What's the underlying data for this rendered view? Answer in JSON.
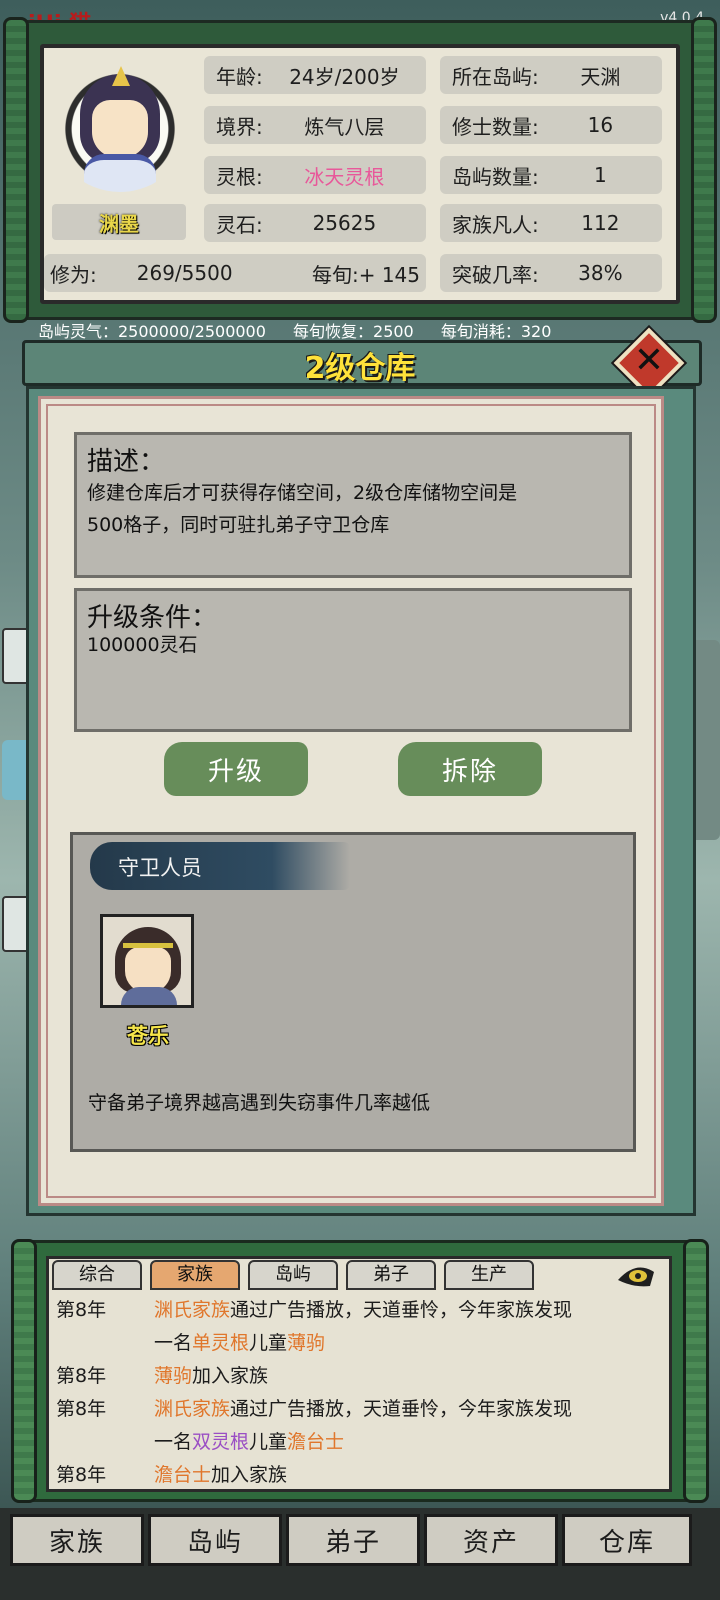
{
  "app": {
    "version": "v4.0.4",
    "corner_logo": "iHi 猫"
  },
  "character": {
    "name": "渊墨",
    "stats_left": [
      {
        "key": "年龄:",
        "value": "24岁/200岁"
      },
      {
        "key": "境界:",
        "value": "炼气八层"
      },
      {
        "key": "灵根:",
        "value": "冰天灵根"
      },
      {
        "key": "灵石:",
        "value": "25625"
      }
    ],
    "stats_right": [
      {
        "key": "所在岛屿:",
        "value": "天渊"
      },
      {
        "key": "修士数量:",
        "value": "16"
      },
      {
        "key": "岛屿数量:",
        "value": "1"
      },
      {
        "key": "家族凡人:",
        "value": "112"
      }
    ],
    "cultivation_key": "修为:",
    "cultivation_value": "269/5500",
    "per_turn": "每旬:+ 145",
    "breakthrough_key": "突破几率:",
    "breakthrough_value": "38%"
  },
  "island_qi": {
    "qi": "岛屿灵气：2500000/2500000",
    "recover": "每旬恢复：2500",
    "consume": "每旬消耗：320"
  },
  "dialog": {
    "title": "2级仓库",
    "description_title": "描述：",
    "description_line1": "修建仓库后才可获得存储空间，2级仓库储物空间是",
    "description_line2": "500格子，同时可驻扎弟子守卫仓库",
    "upgrade_title": "升级条件：",
    "upgrade_body": "100000灵石",
    "upgrade_button": "升级",
    "demolish_button": "拆除",
    "guard_title": "守卫人员",
    "guard_name": "苍乐",
    "guard_note": "守备弟子境界越高遇到失窃事件几率越低"
  },
  "log": {
    "tabs": [
      "综合",
      "家族",
      "岛屿",
      "弟子",
      "生产"
    ],
    "active_tab": "家族",
    "entries": [
      {
        "year": "第8年",
        "parts": [
          [
            "渊氏家族",
            "o"
          ],
          [
            "通过广告播放，天道垂怜，今年家族发现",
            ""
          ]
        ]
      },
      {
        "year": "",
        "parts": [
          [
            "一名",
            ""
          ],
          [
            "单灵根",
            "o"
          ],
          [
            "儿童",
            ""
          ],
          [
            "薄驹",
            "o"
          ]
        ]
      },
      {
        "year": "第8年",
        "parts": [
          [
            "薄驹",
            "o"
          ],
          [
            "加入家族",
            ""
          ]
        ]
      },
      {
        "year": "第8年",
        "parts": [
          [
            "渊氏家族",
            "o"
          ],
          [
            "通过广告播放，天道垂怜，今年家族发现",
            ""
          ]
        ]
      },
      {
        "year": "",
        "parts": [
          [
            "一名",
            ""
          ],
          [
            "双灵根",
            "p"
          ],
          [
            "儿童",
            ""
          ],
          [
            "澹台士",
            "o"
          ]
        ]
      },
      {
        "year": "第8年",
        "parts": [
          [
            "澹台士",
            "o"
          ],
          [
            "加入家族",
            ""
          ]
        ]
      }
    ]
  },
  "bottom_nav": [
    "家族",
    "岛屿",
    "弟子",
    "资产",
    "仓库"
  ],
  "colors": {
    "accent_title": "#ffe23a",
    "pink_spirit_root": "#e8589a",
    "orange_highlight": "#e0762b",
    "purple_highlight": "#9a4ec4",
    "button_green": "#678d5a"
  }
}
